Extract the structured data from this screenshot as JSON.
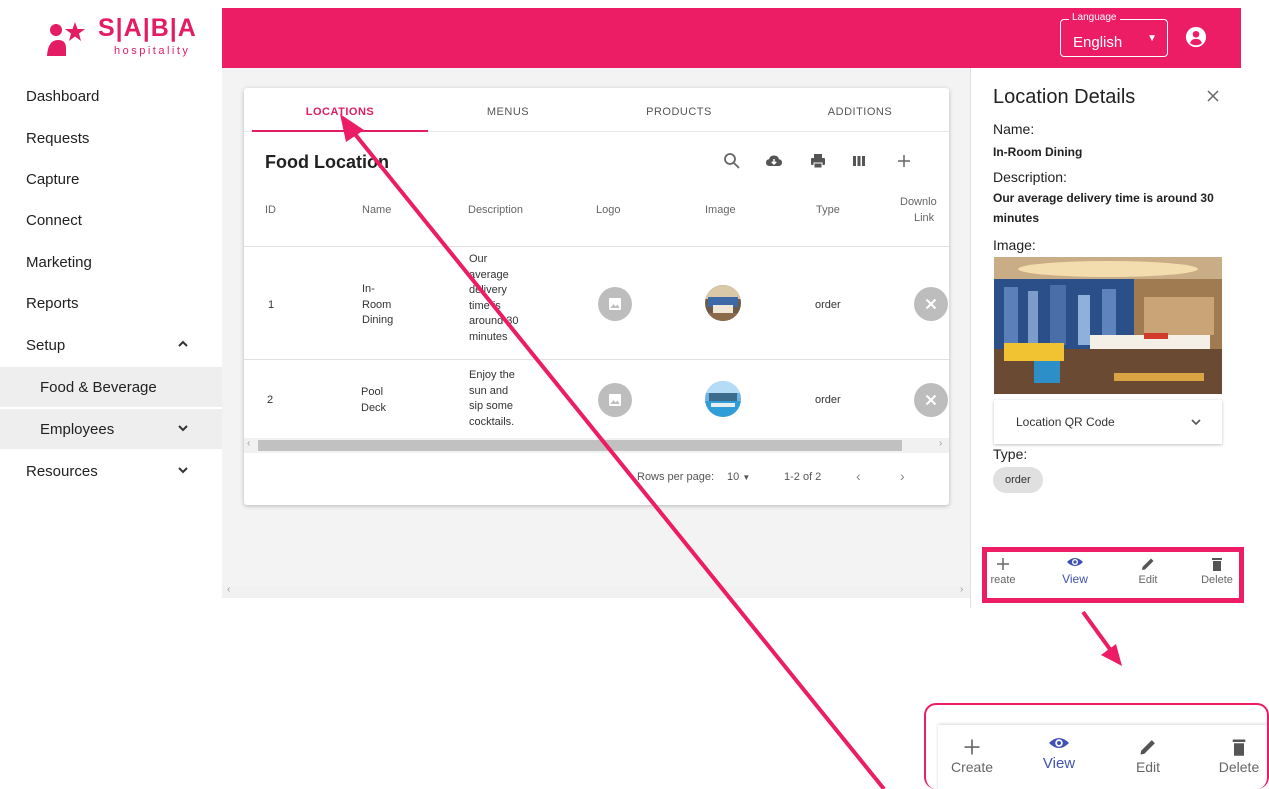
{
  "brand": {
    "name": "S|A|B|A",
    "tagline": "hospitality"
  },
  "colors": {
    "accent": "#ec1d65",
    "selected": "#3f51b5"
  },
  "language": {
    "label": "Language",
    "value": "English"
  },
  "sidebar": {
    "items": [
      {
        "label": "Dashboard"
      },
      {
        "label": "Requests"
      },
      {
        "label": "Capture"
      },
      {
        "label": "Connect"
      },
      {
        "label": "Marketing"
      },
      {
        "label": "Reports"
      },
      {
        "label": "Setup",
        "expanded": true
      },
      {
        "label": "Food & Beverage",
        "sub": true
      },
      {
        "label": "Employees",
        "sub": true
      },
      {
        "label": "Resources"
      }
    ]
  },
  "tabs": [
    "LOCATIONS",
    "MENUS",
    "PRODUCTS",
    "ADDITIONS"
  ],
  "table": {
    "title": "Food Location",
    "columns": [
      "ID",
      "Name",
      "Description",
      "Logo",
      "Image",
      "Type",
      "Downlo",
      "Link"
    ],
    "rows": [
      {
        "id": "1",
        "name": [
          "In-",
          "Room",
          "Dining"
        ],
        "description": [
          "Our",
          "average",
          "delivery",
          "time is",
          "around 30",
          "minutes"
        ],
        "type": "order"
      },
      {
        "id": "2",
        "name": [
          "Pool",
          "Deck"
        ],
        "description": [
          "Enjoy the",
          "sun and",
          "sip some",
          "cocktails."
        ],
        "type": "order"
      }
    ],
    "rows_per_page_label": "Rows per page:",
    "rows_per_page": "10",
    "range": "1-2 of 2"
  },
  "details": {
    "title": "Location Details",
    "name_label": "Name:",
    "name": "In-Room Dining",
    "description_label": "Description:",
    "description": "Our average delivery time is around 30 minutes",
    "image_label": "Image:",
    "qr_label": "Location QR Code",
    "type_label": "Type:",
    "type": "order"
  },
  "actions": {
    "create": "reate",
    "view": "View",
    "edit": "Edit",
    "delete": "Delete"
  },
  "zoom_actions": {
    "create": "Create",
    "view": "View",
    "edit": "Edit",
    "delete": "Delete"
  }
}
